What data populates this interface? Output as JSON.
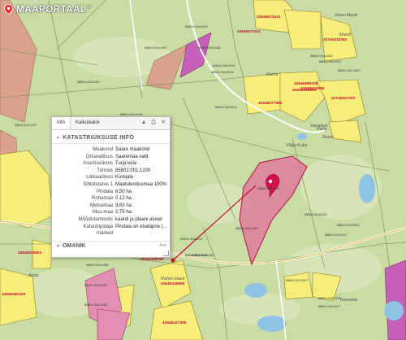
{
  "app": {
    "logo_text": "MAAPORTAAL",
    "logo_suffix": "ee"
  },
  "panel": {
    "tabs": [
      "Info",
      "Kalkulaator"
    ],
    "section_title": "KATASTRIÜKSUSE INFO",
    "rows": [
      {
        "label": "Maakond",
        "value": "Saare maakond"
      },
      {
        "label": "Omavalitsus",
        "value": "Saaremaa vald"
      },
      {
        "label": "Asustusüksus",
        "value": "Turja küla"
      },
      {
        "label": "Tunnus",
        "value": "85801:001:1200"
      },
      {
        "label": "Lähiaadress",
        "value": "Kurejala"
      },
      {
        "label": "Sihtotstarve 1",
        "value": "Maatulundusmaa 100%"
      },
      {
        "label": "Pindala",
        "value": "6.50 ha"
      },
      {
        "label": "Rohumaa",
        "value": "0.12 ha"
      },
      {
        "label": "Metsamaa",
        "value": "3.63 ha"
      },
      {
        "label": "Muu maa",
        "value": "2.75 ha"
      },
      {
        "label": "Mõõdistamisviis",
        "value": "kaardi ja plaani alusel"
      },
      {
        "label": "Katastripidaja",
        "value": "Pindala on ebatäpne (..."
      },
      {
        "label": "märked",
        "value": ""
      }
    ],
    "second_section": "OMANIK",
    "more_label": "Ava"
  },
  "map": {
    "parcel_ids": [
      {
        "text": "85801:004:0167"
      },
      {
        "text": "85801:004:0197"
      },
      {
        "text": "85801:004:0109"
      },
      {
        "text": "85801:004:0198"
      },
      {
        "text": "85801:004:0180"
      },
      {
        "text": "85801:004:0241"
      },
      {
        "text": "85801:004:0210"
      },
      {
        "text": "85801:004:0226"
      },
      {
        "text": "85801:004:0093"
      },
      {
        "text": "85801:004:1028"
      },
      {
        "text": "85801:004:0220"
      },
      {
        "text": "85801:001:1067"
      },
      {
        "text": "85801:001:1200"
      },
      {
        "text": "85801:004:0148"
      },
      {
        "text": "85801:004:0221"
      },
      {
        "text": "85801:004:0192"
      },
      {
        "text": "85801:004:0206"
      },
      {
        "text": "85801:004:0223"
      },
      {
        "text": "85801:004:0247"
      },
      {
        "text": "85801:004:0225"
      },
      {
        "text": "85801:004:0227"
      },
      {
        "text": "85801:004:0160"
      },
      {
        "text": "85801:004:0438"
      },
      {
        "text": "85801:004:0200"
      },
      {
        "text": "85801:004:0169"
      },
      {
        "text": "85801:001:0007"
      },
      {
        "text": "85801:004:0182"
      }
    ],
    "red_ids": [
      {
        "text": "43646671614"
      },
      {
        "text": "43646671611"
      },
      {
        "text": "43746310263"
      },
      {
        "text": "43646599208"
      },
      {
        "text": "43646598964"
      },
      {
        "text": "43646577586"
      },
      {
        "text": "43746537003"
      },
      {
        "text": "43646525998"
      },
      {
        "text": "43646468629"
      },
      {
        "text": "43646439890"
      },
      {
        "text": "43646427408"
      },
      {
        "text": "43646481229"
      },
      {
        "text": "43546508803"
      }
    ],
    "place_names": [
      {
        "text": "Vana-Mardi"
      },
      {
        "text": "Mardi"
      },
      {
        "text": "Rahni"
      },
      {
        "text": "Reinu"
      },
      {
        "text": "Rahni-Jaani"
      },
      {
        "text": "Ansu"
      },
      {
        "text": "Välja-Kuke"
      },
      {
        "text": "Rehe"
      },
      {
        "text": "Vanaõue"
      },
      {
        "text": "Toomase"
      }
    ],
    "colors": {
      "field": "#c9dca4",
      "yellow": "#f6ed7a",
      "pink": "#e38fb3",
      "magenta": "#c65fb7",
      "salmon": "#d9a28a",
      "water": "#8fc3e3",
      "marker": "#d60f4b"
    }
  }
}
